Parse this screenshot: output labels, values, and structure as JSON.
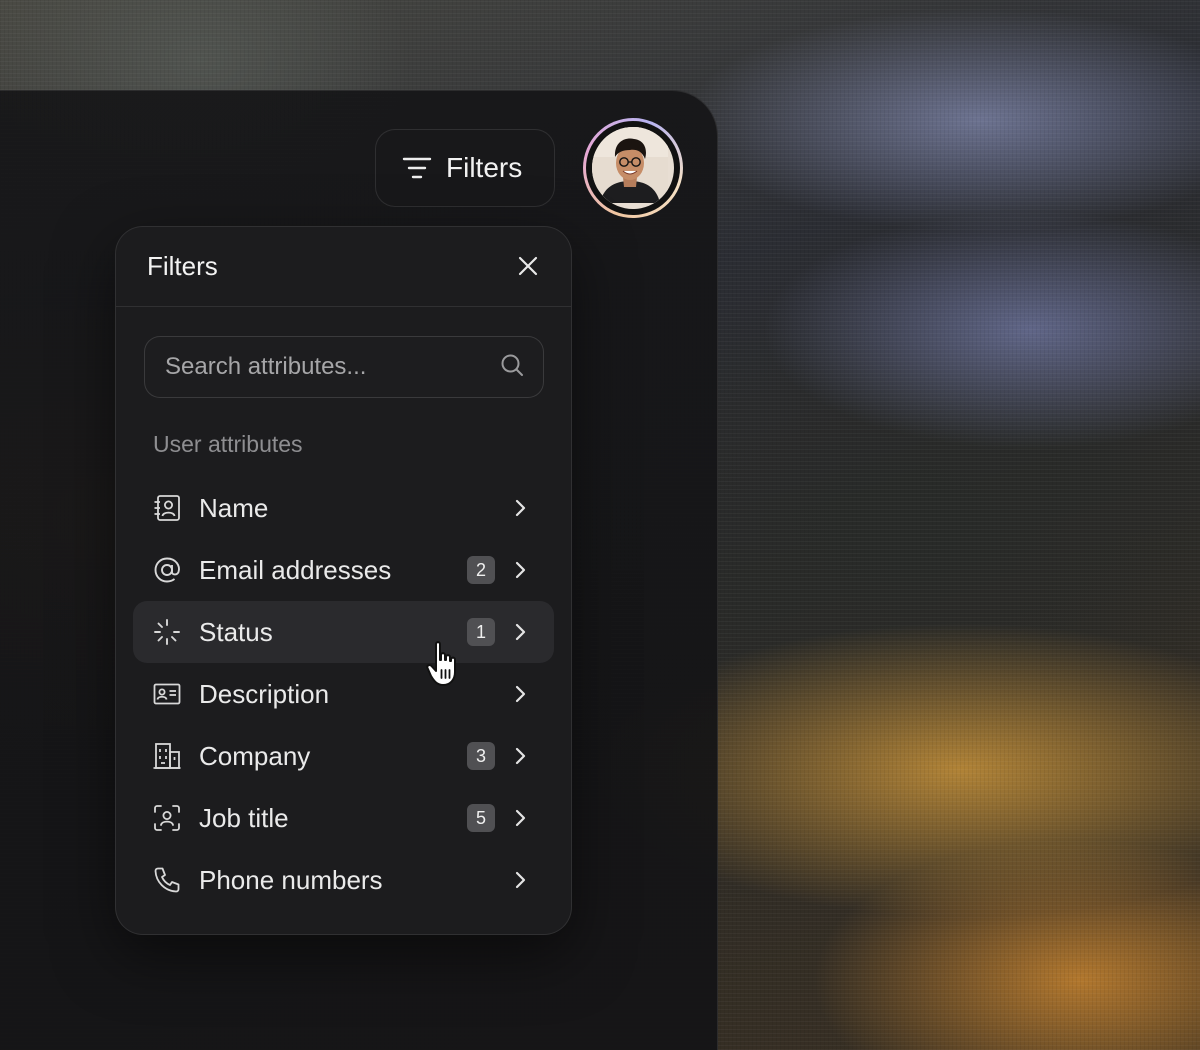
{
  "toolbar": {
    "filters_label": "Filters",
    "filter_icon": "filter-lines-icon"
  },
  "user": {
    "avatar_icon": "user-avatar"
  },
  "panel": {
    "title": "Filters",
    "close_icon": "close-icon",
    "search": {
      "placeholder": "Search attributes...",
      "value": "",
      "icon": "search-icon"
    },
    "section_label": "User attributes",
    "items": [
      {
        "label": "Name",
        "icon": "contact-book-icon",
        "badge": ""
      },
      {
        "label": "Email addresses",
        "icon": "at-sign-icon",
        "badge": "2"
      },
      {
        "label": "Status",
        "icon": "loader-icon",
        "badge": "1"
      },
      {
        "label": "Description",
        "icon": "id-card-icon",
        "badge": ""
      },
      {
        "label": "Company",
        "icon": "building-icon",
        "badge": "3"
      },
      {
        "label": "Job title",
        "icon": "user-scan-icon",
        "badge": "5"
      },
      {
        "label": "Phone numbers",
        "icon": "phone-icon",
        "badge": ""
      }
    ],
    "active_item": "Status"
  },
  "colors": {
    "panel_bg": "#1c1c1e",
    "badge_bg": "#505053",
    "text": "#eaeaea",
    "muted": "#8e8e91"
  }
}
